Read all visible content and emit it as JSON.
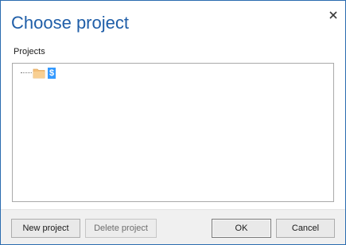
{
  "dialog": {
    "title": "Choose project",
    "close_glyph": "✕"
  },
  "projects": {
    "label": "Projects",
    "tree": [
      {
        "label": "$",
        "icon": "folder-icon",
        "selected": true
      }
    ]
  },
  "buttons": {
    "new_project": "New project",
    "delete_project": "Delete project",
    "ok": "OK",
    "cancel": "Cancel"
  },
  "colors": {
    "title": "#1f5ea8",
    "selection": "#3399ff",
    "folder": "#f5c07a"
  }
}
